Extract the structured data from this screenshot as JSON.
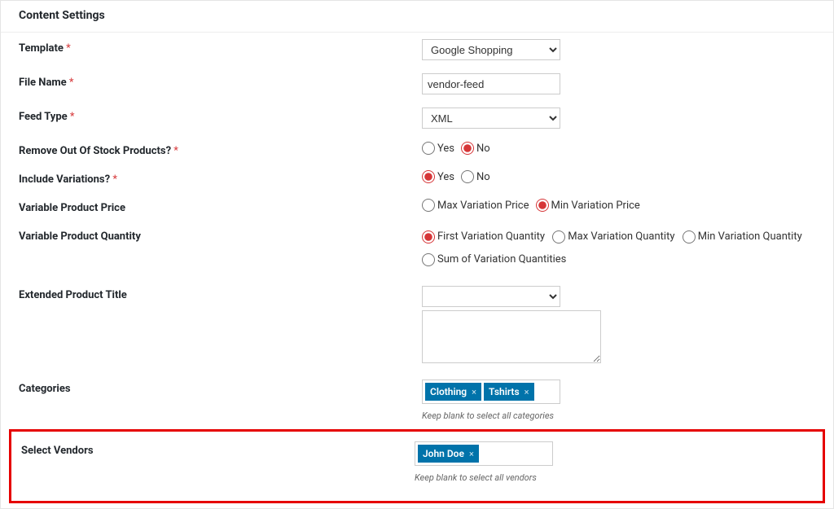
{
  "header": {
    "title": "Content Settings"
  },
  "fields": {
    "template": {
      "label": "Template",
      "value": "Google Shopping"
    },
    "fileName": {
      "label": "File Name",
      "value": "vendor-feed"
    },
    "feedType": {
      "label": "Feed Type",
      "value": "XML"
    },
    "removeOutOfStock": {
      "label": "Remove Out Of Stock Products?",
      "options": {
        "yes": "Yes",
        "no": "No"
      },
      "selected": "no"
    },
    "includeVariations": {
      "label": "Include Variations?",
      "options": {
        "yes": "Yes",
        "no": "No"
      },
      "selected": "yes"
    },
    "variablePrice": {
      "label": "Variable Product Price",
      "options": {
        "max": "Max Variation Price",
        "min": "Min Variation Price"
      },
      "selected": "min"
    },
    "variableQty": {
      "label": "Variable Product Quantity",
      "options": {
        "first": "First Variation Quantity",
        "max": "Max Variation Quantity",
        "min": "Min Variation Quantity",
        "sum": "Sum of Variation Quantities"
      },
      "selected": "first"
    },
    "extendedTitle": {
      "label": "Extended Product Title",
      "selectValue": "",
      "textValue": ""
    },
    "categories": {
      "label": "Categories",
      "tags": [
        "Clothing",
        "Tshirts"
      ],
      "helper": "Keep blank to select all categories"
    },
    "vendors": {
      "label": "Select Vendors",
      "tags": [
        "John Doe"
      ],
      "helper": "Keep blank to select all vendors"
    }
  }
}
